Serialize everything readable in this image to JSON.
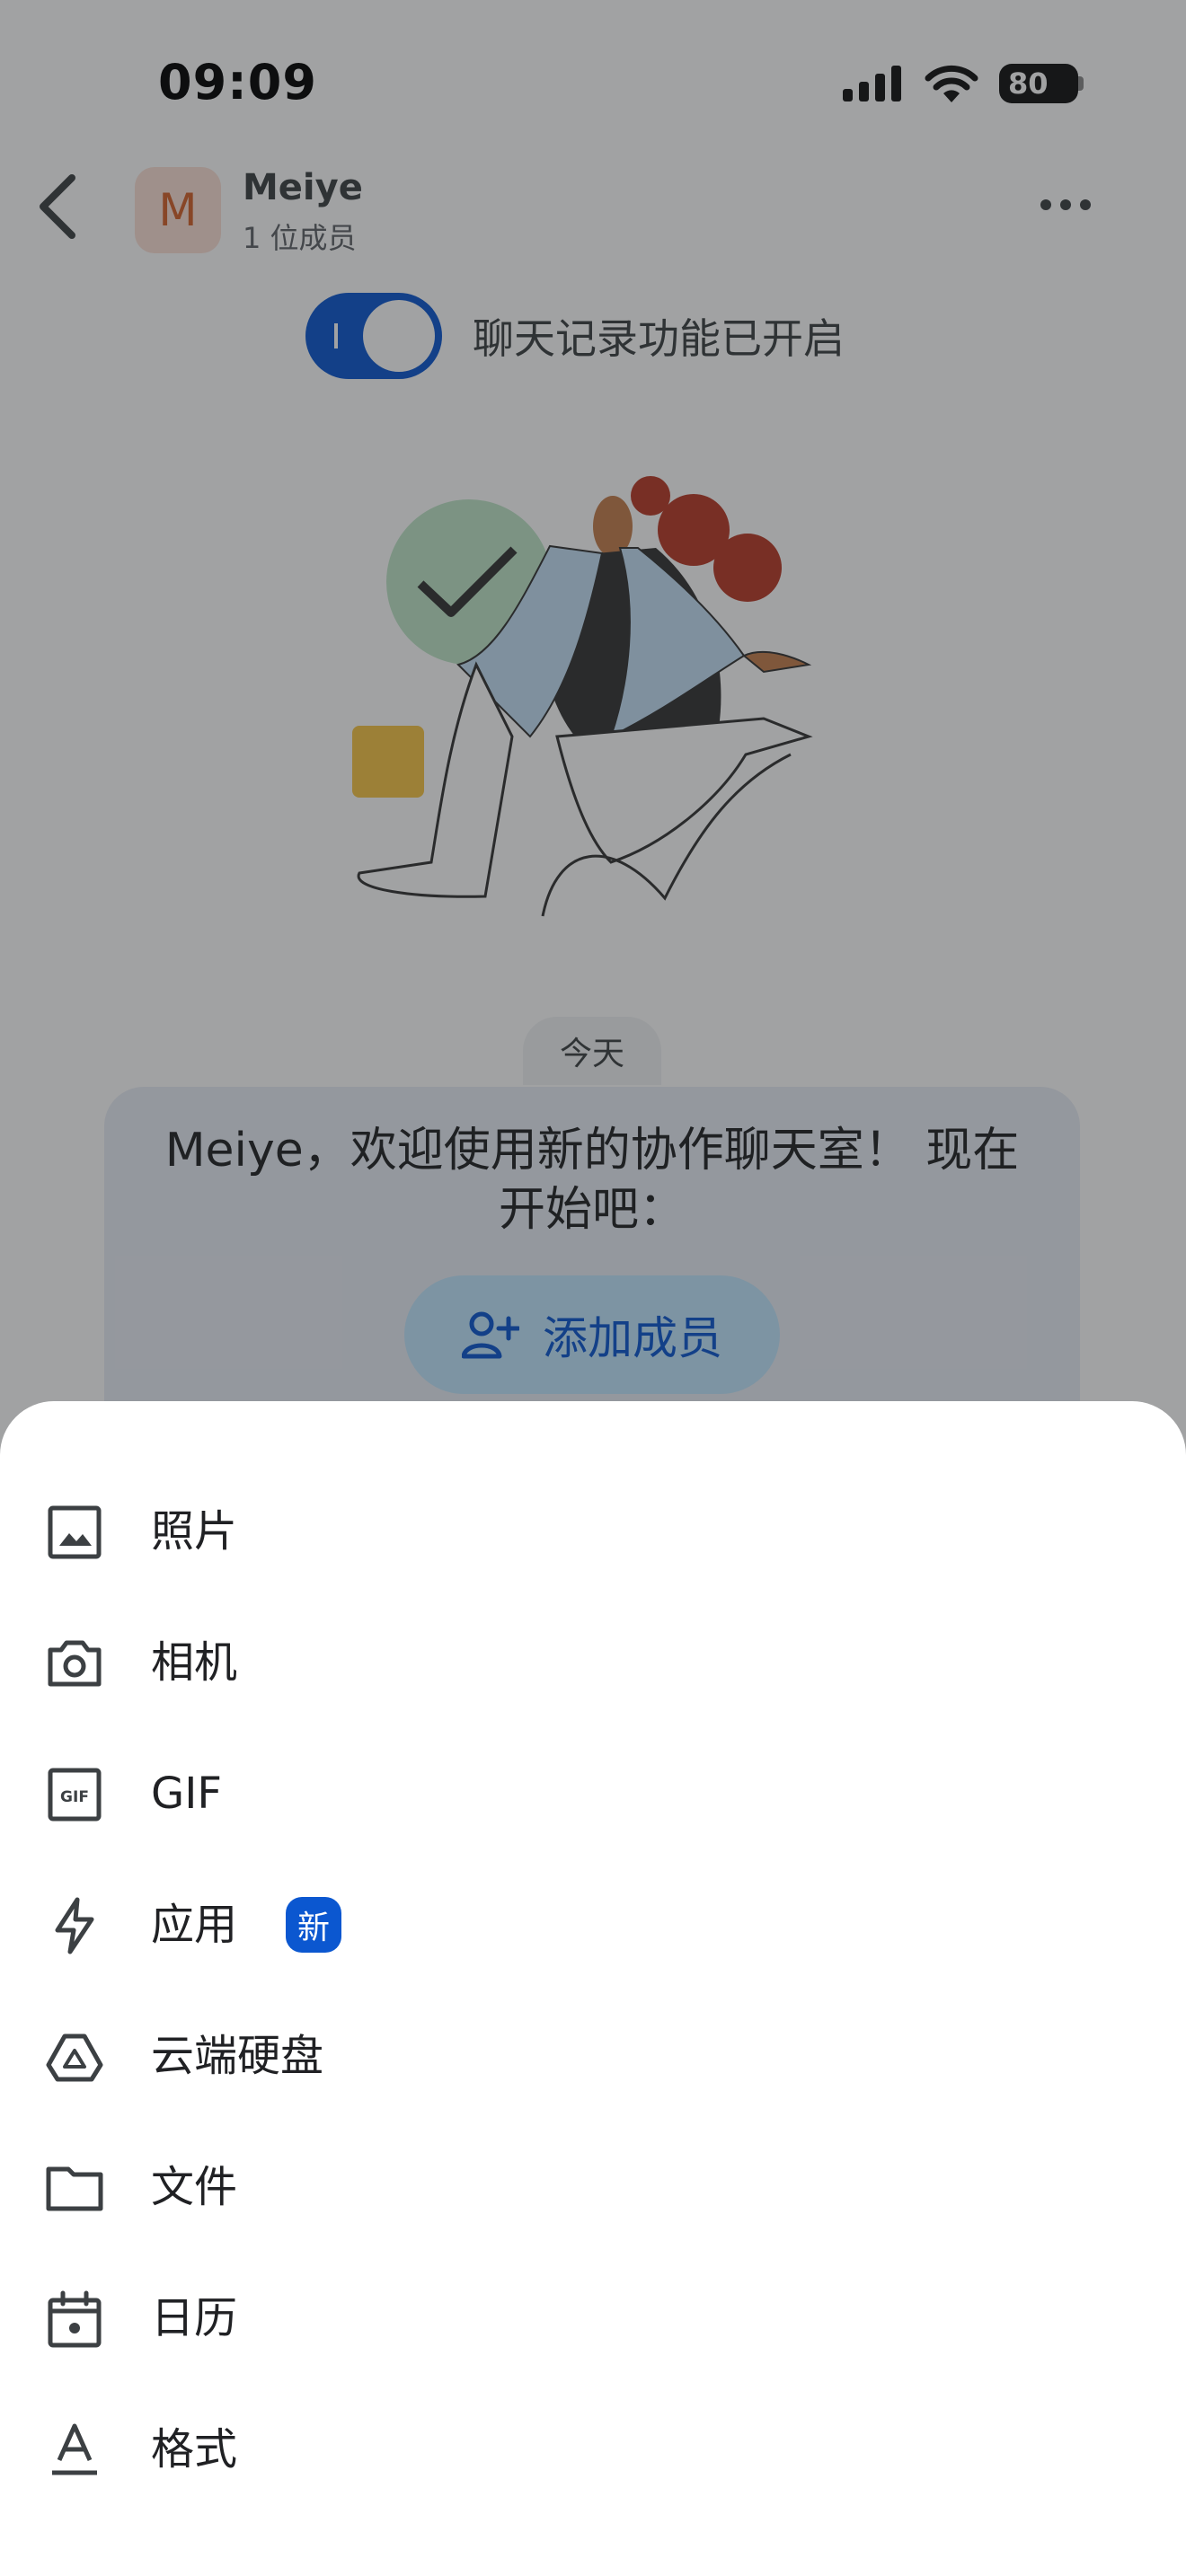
{
  "status_bar": {
    "time": "09:09",
    "battery": "80"
  },
  "header": {
    "avatar_letter": "M",
    "title": "Meiye",
    "subtitle": "1 位成员"
  },
  "history": {
    "label": "聊天记录功能已开启",
    "enabled": true
  },
  "chat": {
    "date_label": "今天",
    "welcome_text": "Meiye，欢迎使用新的协作聊天室！ 现在开始吧：",
    "add_member_label": "添加成员"
  },
  "menu": {
    "items": [
      {
        "label": "照片",
        "icon": "image-icon"
      },
      {
        "label": "相机",
        "icon": "camera-icon"
      },
      {
        "label": "GIF",
        "icon": "gif-icon"
      },
      {
        "label": "应用",
        "icon": "lightning-icon",
        "badge": "新"
      },
      {
        "label": "云端硬盘",
        "icon": "drive-icon"
      },
      {
        "label": "文件",
        "icon": "folder-icon"
      },
      {
        "label": "日历",
        "icon": "calendar-icon"
      },
      {
        "label": "格式",
        "icon": "text-format-icon"
      }
    ]
  },
  "colors": {
    "accent": "#0b57d0",
    "avatar_bg": "#fbe1d6",
    "avatar_fg": "#d5612a",
    "card_bg": "#e9eef6"
  }
}
